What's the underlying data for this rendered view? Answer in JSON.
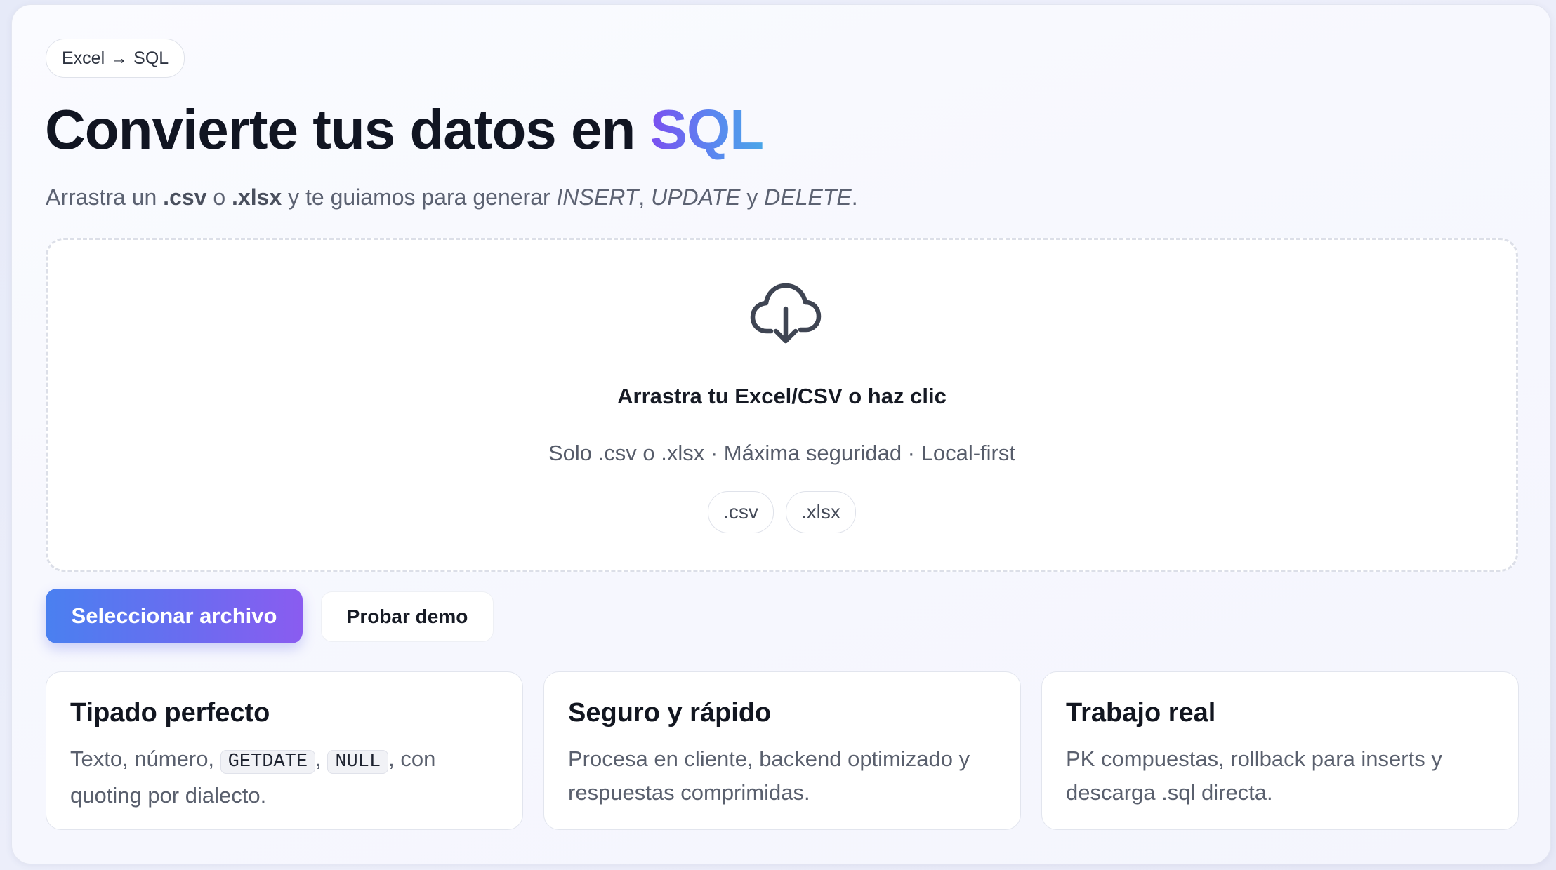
{
  "badge": {
    "left": "Excel",
    "arrow": "→",
    "right": "SQL"
  },
  "hero": {
    "title_main": "Convierte tus datos en",
    "title_accent": "SQL",
    "subtitle": {
      "p1": "Arrastra un",
      "ext1": ".csv",
      "p2": "o",
      "ext2": ".xlsx",
      "p3": "y te guiamos para generar",
      "op1": "INSERT",
      "sep1": ",",
      "op2": "UPDATE",
      "p4": "y",
      "op3": "DELETE",
      "end": "."
    }
  },
  "dropzone": {
    "icon": "cloud-download-icon",
    "title": "Arrastra tu Excel/CSV o haz clic",
    "subtitle": "Solo .csv o .xlsx · Máxima seguridad · Local-first",
    "chips": [
      ".csv",
      ".xlsx"
    ]
  },
  "actions": {
    "primary_label": "Seleccionar archivo",
    "secondary_label": "Probar demo"
  },
  "colors": {
    "accent_gradient_start": "#7b4ff0",
    "accent_gradient_end": "#4aa6e8",
    "button_gradient_start": "#4a80f0",
    "button_gradient_end": "#8a5cf0"
  },
  "features": [
    {
      "title": "Tipado perfecto",
      "text_before": "Texto, número,",
      "code1": "GETDATE",
      "sep": ",",
      "code2": "NULL",
      "text_after": ", con quoting por dialecto."
    },
    {
      "title": "Seguro y rápido",
      "text": "Procesa en cliente, backend optimizado y respuestas comprimidas."
    },
    {
      "title": "Trabajo real",
      "text": "PK compuestas, rollback para inserts y descarga .sql directa."
    }
  ]
}
